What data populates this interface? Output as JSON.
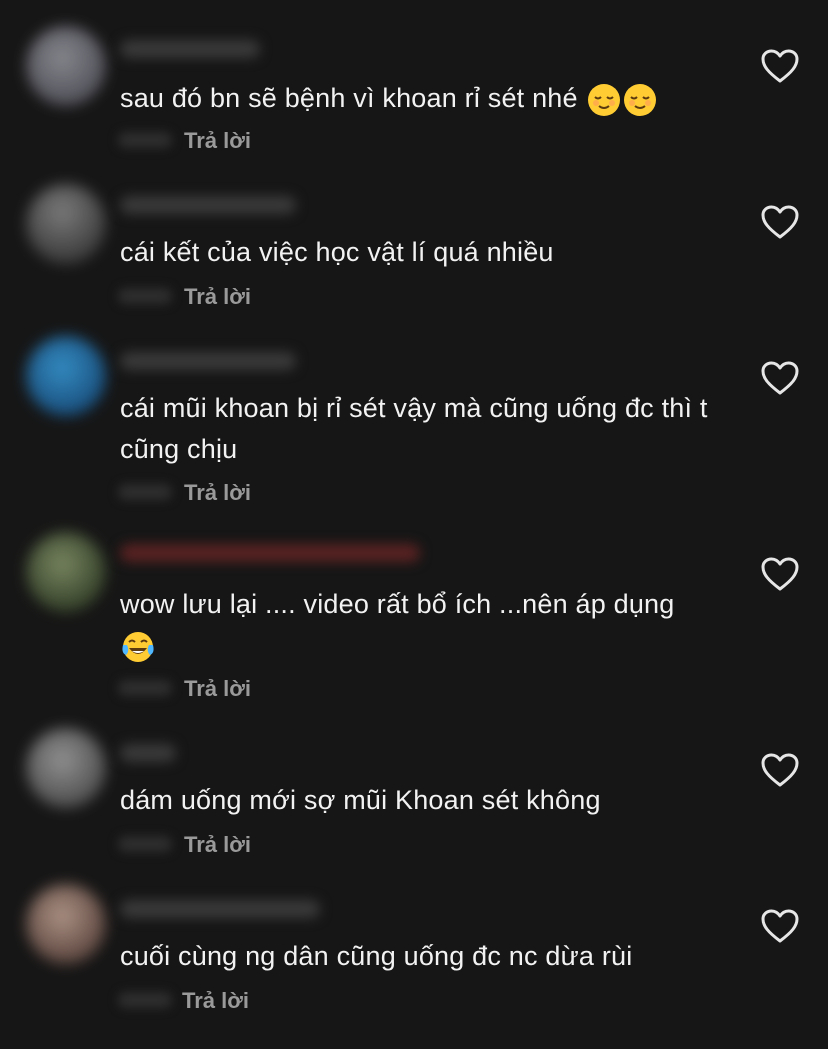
{
  "comments": [
    {
      "text": "sau đó bn sẽ bệnh vì khoan rỉ sét nhé",
      "emojis": [
        "relieved-face",
        "relieved-face"
      ],
      "reply_label": "Trả lời"
    },
    {
      "text": "cái kết của việc học vật lí quá nhiều",
      "emojis": [],
      "reply_label": "Trả lời"
    },
    {
      "text": "cái mũi khoan bị rỉ sét vậy mà cũng uống đc thì t cũng chịu",
      "emojis": [],
      "reply_label": "Trả lời"
    },
    {
      "text": "wow lưu lại .... video rất bổ ích ...nên áp dụng",
      "emojis": [
        "tears-of-joy-face"
      ],
      "reply_label": "Trả lời"
    },
    {
      "text": "dám uống mới sợ mũi Khoan sét không",
      "emojis": [],
      "reply_label": "Trả lời"
    },
    {
      "text": "cuối cùng ng dân cũng uống đc nc dừa rùi",
      "emojis": [],
      "reply_label": "Trả lời"
    }
  ],
  "colors": {
    "background": "#161616",
    "text": "#f2f2f2",
    "reply": "#9a9a9a"
  },
  "icons": {
    "like": "heart-outline-icon"
  }
}
